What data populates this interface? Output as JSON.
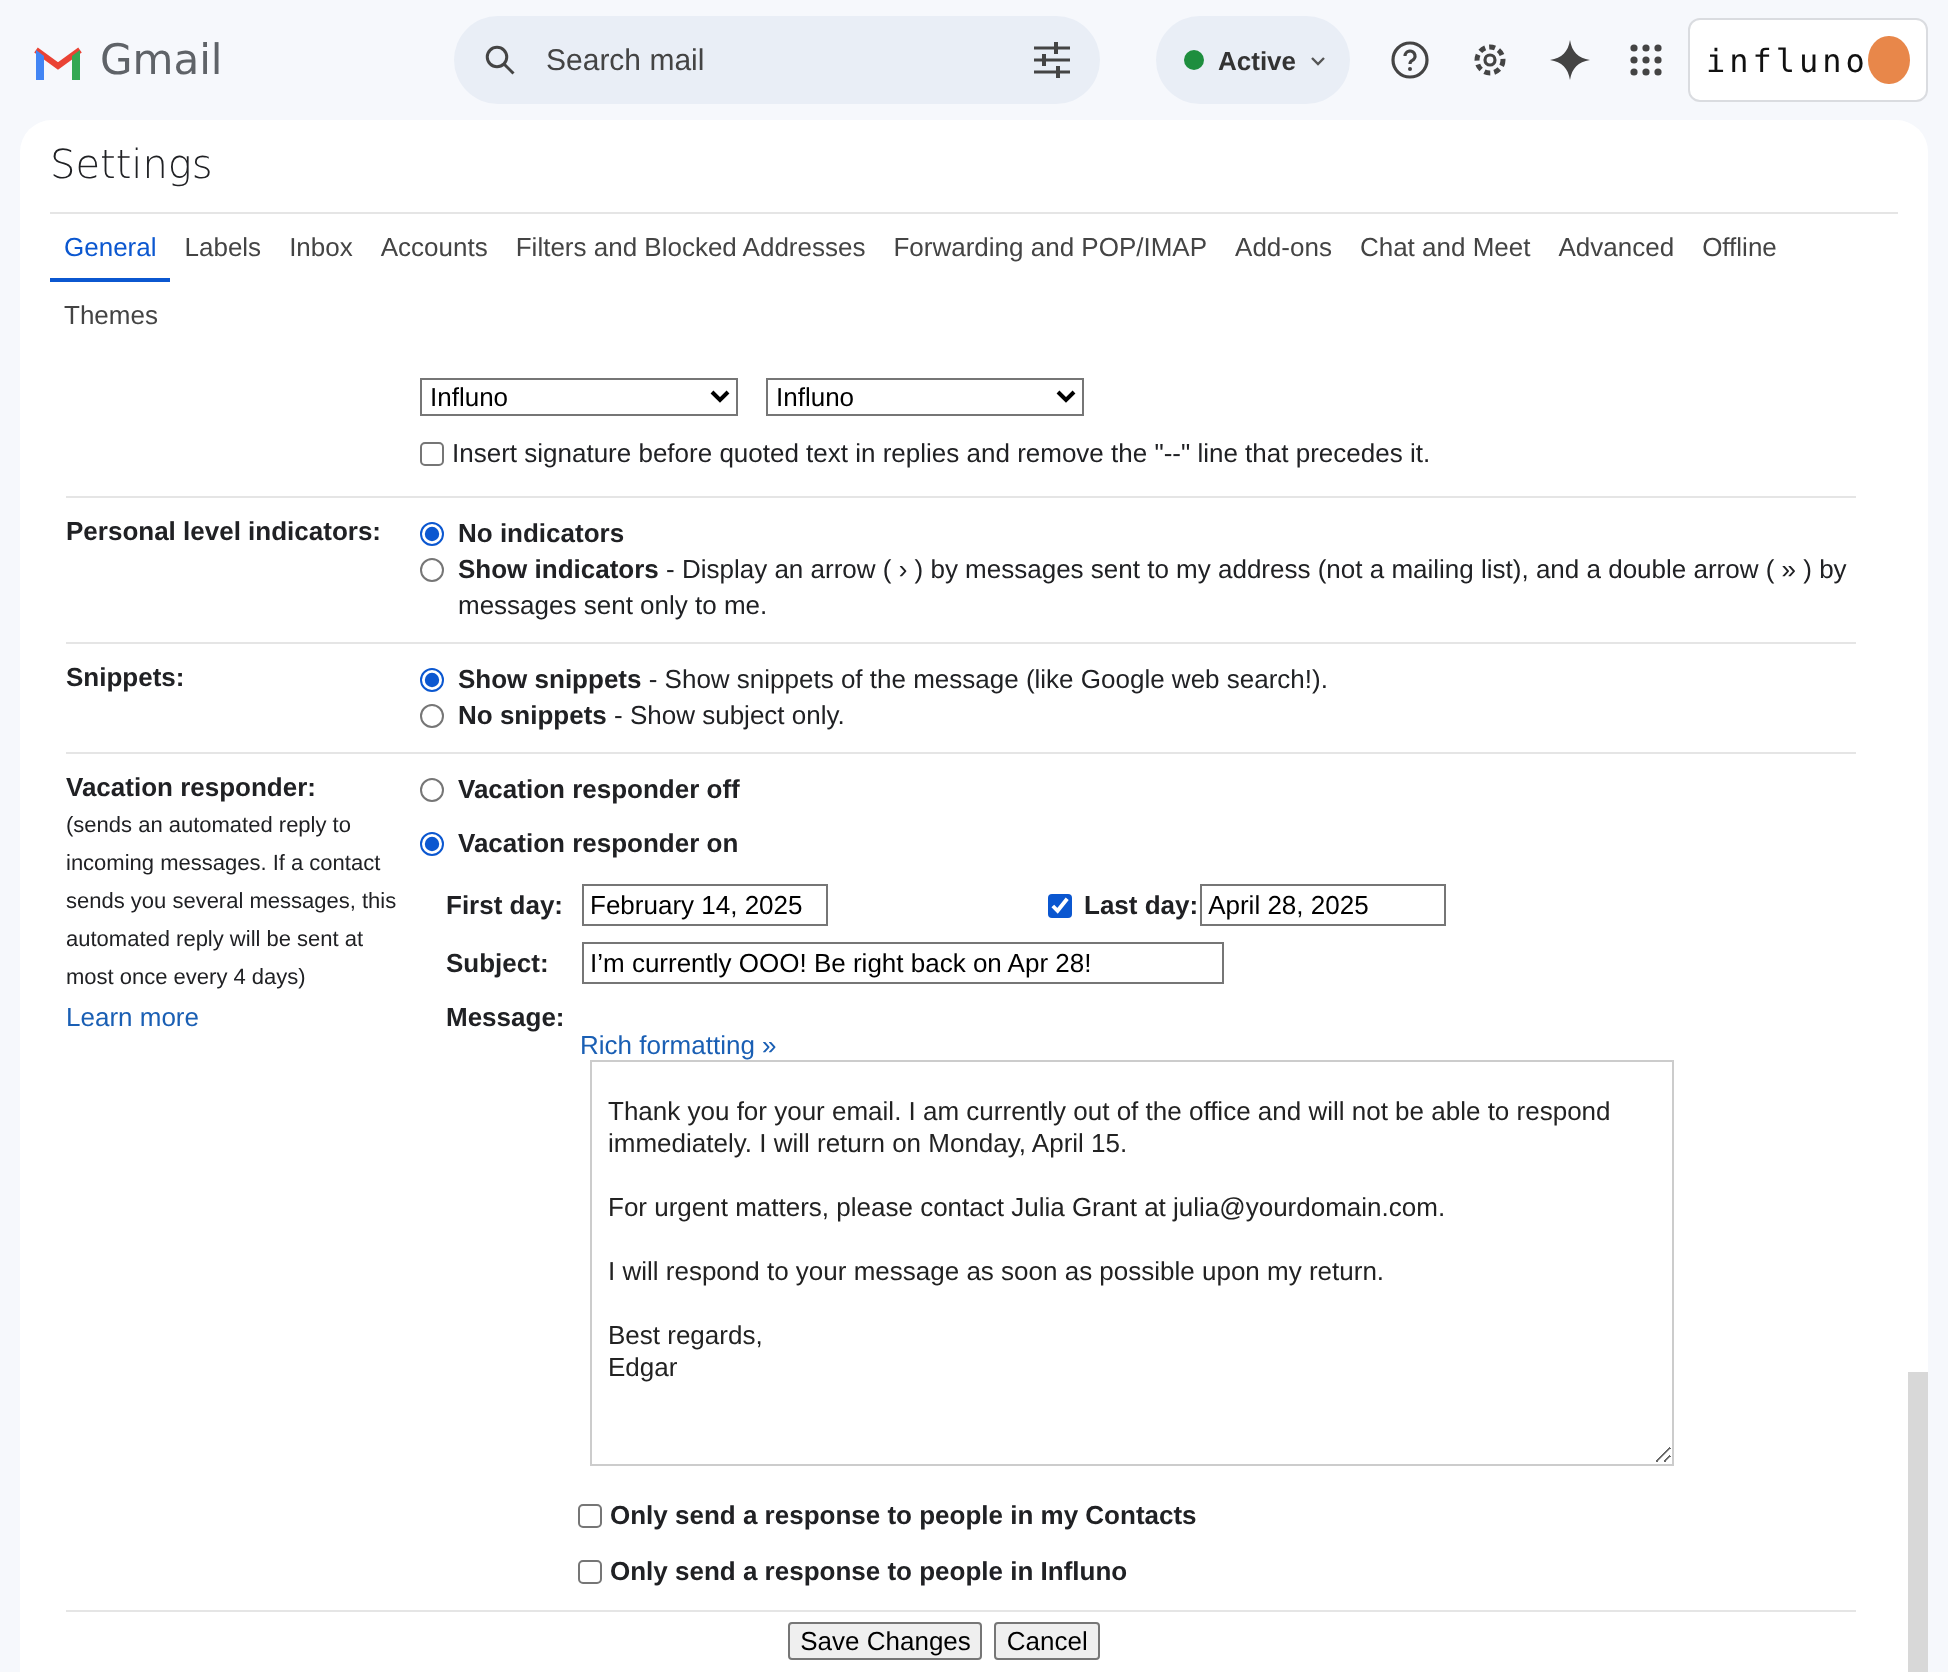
{
  "header": {
    "logo_text": "Gmail",
    "search": {
      "placeholder": "Search mail"
    },
    "status": {
      "label": "Active",
      "color": "#1e8e3e"
    },
    "account": {
      "brand": "influno"
    }
  },
  "settings": {
    "title": "Settings",
    "tabs": [
      {
        "label": "General",
        "selected": true
      },
      {
        "label": "Labels",
        "selected": false
      },
      {
        "label": "Inbox",
        "selected": false
      },
      {
        "label": "Accounts",
        "selected": false
      },
      {
        "label": "Filters and Blocked Addresses",
        "selected": false
      },
      {
        "label": "Forwarding and POP/IMAP",
        "selected": false
      },
      {
        "label": "Add-ons",
        "selected": false
      },
      {
        "label": "Chat and Meet",
        "selected": false
      },
      {
        "label": "Advanced",
        "selected": false
      },
      {
        "label": "Offline",
        "selected": false
      },
      {
        "label": "Themes",
        "selected": false
      }
    ]
  },
  "signature": {
    "selects": [
      "Influno",
      "Influno"
    ],
    "checkbox": {
      "label": "Insert signature before quoted text in replies and remove the \"--\" line that precedes it.",
      "checked": false
    }
  },
  "sections": [
    {
      "label": "Personal level indicators:",
      "options": [
        {
          "title": "No indicators",
          "selected": true
        },
        {
          "title": "Show indicators",
          "description": " - Display an arrow ( › ) by messages sent to my address (not a mailing list), and a double arrow ( » ) by messages sent only to me.",
          "selected": false
        }
      ]
    },
    {
      "label": "Snippets:",
      "options": [
        {
          "title": "Show snippets",
          "description": " - Show snippets of the message (like Google web search!).",
          "selected": true
        },
        {
          "title": "No snippets",
          "description": " - Show subject only.",
          "selected": false
        }
      ]
    }
  ],
  "vacation": {
    "label": "Vacation responder:",
    "note": "(sends an automated reply to incoming messages. If a contact sends you several messages, this automated reply will be sent at most once every 4 days)",
    "link": "Learn more",
    "options": [
      {
        "title": "Vacation responder off",
        "selected": false
      },
      {
        "title": "Vacation responder on",
        "selected": true
      }
    ],
    "first_day": {
      "label": "First day:",
      "value": "February 14, 2025"
    },
    "last_day": {
      "label": "Last day:",
      "value": "April 28, 2025",
      "checked": true
    },
    "subject": {
      "label": "Subject:",
      "value": "I’m currently OOO! Be right back on Apr 28!"
    },
    "message": {
      "label": "Message:",
      "rich_link": "Rich formatting »",
      "value": "Thank you for your email. I am currently out of the office and will not be able to respond immediately. I will return on Monday, April 15.\n\nFor urgent matters, please contact Julia Grant at julia@yourdomain.com.\n\nI will respond to your message as soon as possible upon my return.\n\nBest regards,\nEdgar"
    },
    "restrictions": [
      {
        "label": "Only send a response to people in my Contacts",
        "checked": false
      },
      {
        "label": "Only send a response to people in Influno",
        "checked": false
      }
    ]
  },
  "buttons": [
    "Save Changes",
    "Cancel"
  ]
}
